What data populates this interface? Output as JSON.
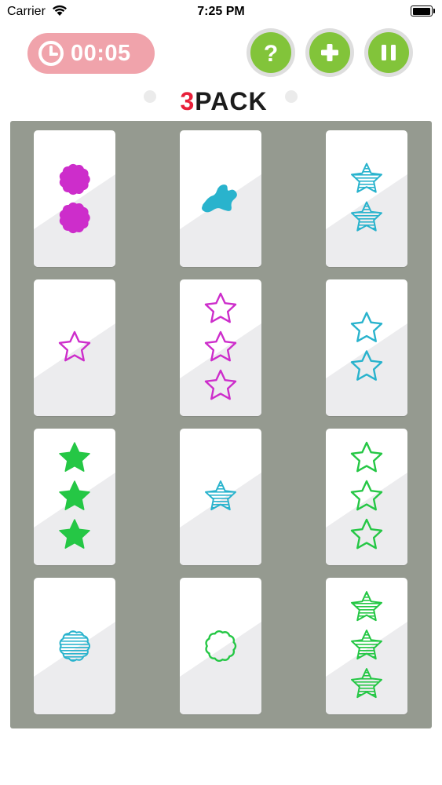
{
  "status_bar": {
    "carrier": "Carrier",
    "time": "7:25 PM"
  },
  "header": {
    "timer": "00:05",
    "help_button": "?",
    "add_button": "+",
    "pause_button": "II",
    "logo_text": "3PACK"
  },
  "colors": {
    "magenta": "#cd2dcb",
    "cyan": "#29b3cd",
    "green": "#25c745",
    "button_green": "#82c43a",
    "timer_pink": "#f0a3ab",
    "board_gray": "#959a90",
    "logo_red": "#e8203a"
  },
  "cards": [
    {
      "count": 2,
      "shape": "flower",
      "fill": "solid",
      "color": "magenta"
    },
    {
      "count": 1,
      "shape": "splat",
      "fill": "solid",
      "color": "cyan"
    },
    {
      "count": 2,
      "shape": "star",
      "fill": "striped",
      "color": "cyan"
    },
    {
      "count": 1,
      "shape": "star",
      "fill": "outline",
      "color": "magenta"
    },
    {
      "count": 3,
      "shape": "star",
      "fill": "outline",
      "color": "magenta"
    },
    {
      "count": 2,
      "shape": "star",
      "fill": "outline",
      "color": "cyan"
    },
    {
      "count": 3,
      "shape": "star",
      "fill": "solid",
      "color": "green"
    },
    {
      "count": 1,
      "shape": "star",
      "fill": "striped",
      "color": "cyan"
    },
    {
      "count": 3,
      "shape": "star",
      "fill": "outline",
      "color": "green"
    },
    {
      "count": 1,
      "shape": "flower",
      "fill": "striped",
      "color": "cyan"
    },
    {
      "count": 1,
      "shape": "flower",
      "fill": "outline",
      "color": "green"
    },
    {
      "count": 3,
      "shape": "star",
      "fill": "striped",
      "color": "green"
    }
  ]
}
